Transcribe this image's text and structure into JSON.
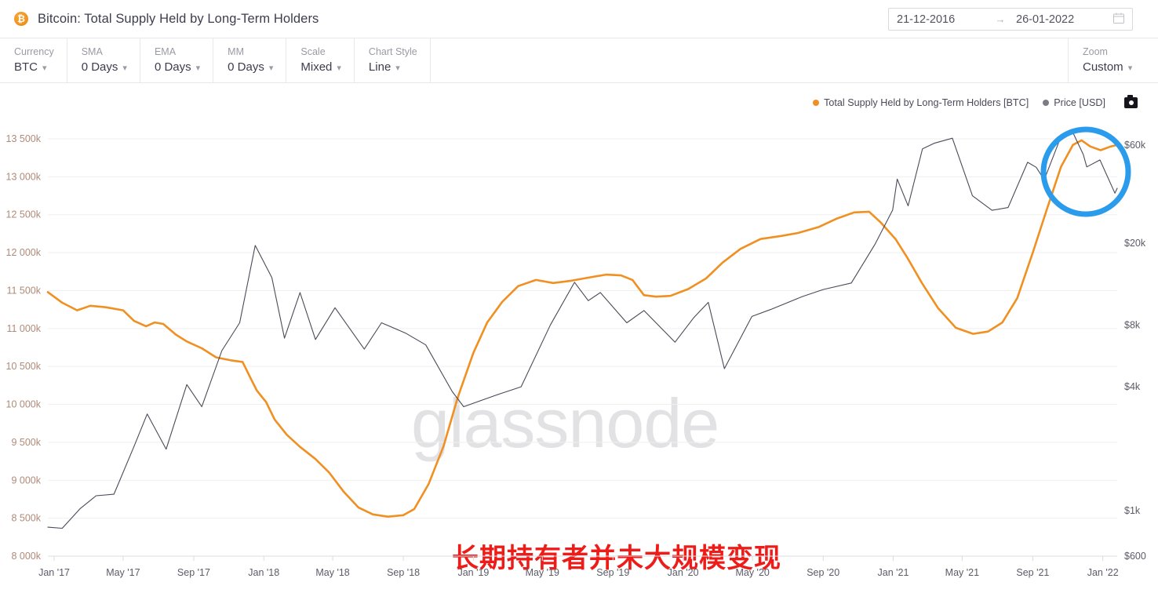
{
  "header": {
    "logo_icon": "bitcoin-icon",
    "logo_glyph": "₿",
    "title": "Bitcoin: Total Supply Held by Long-Term Holders",
    "date_from": "21-12-2016",
    "date_arrow": "→",
    "date_to": "26-01-2022",
    "calendar_icon": "calendar-icon"
  },
  "toolbar": {
    "items": [
      {
        "label": "Currency",
        "value": "BTC"
      },
      {
        "label": "SMA",
        "value": "0 Days"
      },
      {
        "label": "EMA",
        "value": "0 Days"
      },
      {
        "label": "MM",
        "value": "0 Days"
      },
      {
        "label": "Scale",
        "value": "Mixed"
      },
      {
        "label": "Chart Style",
        "value": "Line"
      }
    ],
    "zoom": {
      "label": "Zoom",
      "value": "Custom"
    }
  },
  "legend": {
    "items": [
      {
        "label": "Total Supply Held by Long-Term Holders [BTC]",
        "color": "#f09022"
      },
      {
        "label": "Price [USD]",
        "color": "#7b7b86"
      }
    ],
    "camera_icon": "camera-icon"
  },
  "watermark": "glassnode",
  "annotation": {
    "text": "长期持有者并未大规模变现",
    "color": "#ee1c18",
    "circle": {
      "color": "#2b9bec",
      "cx": 1384,
      "cy": 219,
      "r": 54
    }
  },
  "chart_data": {
    "type": "line",
    "title": "Bitcoin: Total Supply Held by Long-Term Holders",
    "xlabel": "",
    "ylabel": "Total Supply Held by Long-Term Holders [BTC]",
    "y2label": "Price [USD]",
    "grid": true,
    "legend_position": "top-right",
    "x_ticks": [
      "Jan '17",
      "May '17",
      "Sep '17",
      "Jan '18",
      "May '18",
      "Sep '18",
      "Jan '19",
      "May '19",
      "Sep '19",
      "Jan '20",
      "May '20",
      "Sep '20",
      "Jan '21",
      "May '21",
      "Sep '21",
      "Jan '22"
    ],
    "y_left_ticks": [
      "13 500k",
      "13 000k",
      "12 500k",
      "12 000k",
      "11 500k",
      "11 000k",
      "10 500k",
      "10 000k",
      "9 500k",
      "9 000k",
      "8 500k",
      "8 000k"
    ],
    "y_left_values": [
      13500000,
      13000000,
      12500000,
      12000000,
      11500000,
      11000000,
      10500000,
      10000000,
      9500000,
      9000000,
      8500000,
      8000000
    ],
    "y_left_range": [
      8000000,
      13500000
    ],
    "y_right_ticks": [
      "$60k",
      "$20k",
      "$8k",
      "$4k",
      "$1k",
      "$600"
    ],
    "y_right_values": [
      60000,
      20000,
      8000,
      4000,
      1000,
      600
    ],
    "y_right_scale": "log",
    "y_right_range": [
      600,
      70000
    ],
    "x_range": [
      "2016-12-21",
      "2022-01-26"
    ],
    "series": [
      {
        "name": "Total Supply Held by Long-Term Holders [BTC]",
        "color": "#f09022",
        "axis": "left",
        "unit": "BTC",
        "points": [
          {
            "x": "2016-12-21",
            "y": 11480000
          },
          {
            "x": "2017-01-15",
            "y": 11340000
          },
          {
            "x": "2017-02-10",
            "y": 11240000
          },
          {
            "x": "2017-03-05",
            "y": 11300000
          },
          {
            "x": "2017-04-01",
            "y": 11280000
          },
          {
            "x": "2017-05-01",
            "y": 11240000
          },
          {
            "x": "2017-05-20",
            "y": 11100000
          },
          {
            "x": "2017-06-10",
            "y": 11030000
          },
          {
            "x": "2017-06-25",
            "y": 11080000
          },
          {
            "x": "2017-07-10",
            "y": 11060000
          },
          {
            "x": "2017-08-01",
            "y": 10920000
          },
          {
            "x": "2017-08-20",
            "y": 10830000
          },
          {
            "x": "2017-09-15",
            "y": 10740000
          },
          {
            "x": "2017-10-10",
            "y": 10620000
          },
          {
            "x": "2017-11-05",
            "y": 10580000
          },
          {
            "x": "2017-11-25",
            "y": 10560000
          },
          {
            "x": "2017-12-10",
            "y": 10330000
          },
          {
            "x": "2017-12-20",
            "y": 10180000
          },
          {
            "x": "2018-01-05",
            "y": 10030000
          },
          {
            "x": "2018-01-20",
            "y": 9800000
          },
          {
            "x": "2018-02-10",
            "y": 9600000
          },
          {
            "x": "2018-03-05",
            "y": 9440000
          },
          {
            "x": "2018-04-01",
            "y": 9280000
          },
          {
            "x": "2018-04-25",
            "y": 9100000
          },
          {
            "x": "2018-05-20",
            "y": 8850000
          },
          {
            "x": "2018-06-15",
            "y": 8640000
          },
          {
            "x": "2018-07-10",
            "y": 8550000
          },
          {
            "x": "2018-08-05",
            "y": 8520000
          },
          {
            "x": "2018-09-01",
            "y": 8540000
          },
          {
            "x": "2018-09-20",
            "y": 8620000
          },
          {
            "x": "2018-10-15",
            "y": 8950000
          },
          {
            "x": "2018-11-10",
            "y": 9450000
          },
          {
            "x": "2018-12-05",
            "y": 10100000
          },
          {
            "x": "2019-01-01",
            "y": 10680000
          },
          {
            "x": "2019-01-25",
            "y": 11080000
          },
          {
            "x": "2019-02-20",
            "y": 11350000
          },
          {
            "x": "2019-03-20",
            "y": 11560000
          },
          {
            "x": "2019-04-20",
            "y": 11640000
          },
          {
            "x": "2019-05-20",
            "y": 11600000
          },
          {
            "x": "2019-06-20",
            "y": 11630000
          },
          {
            "x": "2019-07-20",
            "y": 11670000
          },
          {
            "x": "2019-08-20",
            "y": 11710000
          },
          {
            "x": "2019-09-15",
            "y": 11700000
          },
          {
            "x": "2019-10-05",
            "y": 11640000
          },
          {
            "x": "2019-10-25",
            "y": 11440000
          },
          {
            "x": "2019-11-15",
            "y": 11420000
          },
          {
            "x": "2019-12-10",
            "y": 11430000
          },
          {
            "x": "2020-01-10",
            "y": 11520000
          },
          {
            "x": "2020-02-10",
            "y": 11660000
          },
          {
            "x": "2020-03-10",
            "y": 11870000
          },
          {
            "x": "2020-04-10",
            "y": 12050000
          },
          {
            "x": "2020-05-15",
            "y": 12180000
          },
          {
            "x": "2020-06-20",
            "y": 12220000
          },
          {
            "x": "2020-07-20",
            "y": 12260000
          },
          {
            "x": "2020-08-25",
            "y": 12340000
          },
          {
            "x": "2020-09-25",
            "y": 12450000
          },
          {
            "x": "2020-10-25",
            "y": 12530000
          },
          {
            "x": "2020-11-20",
            "y": 12540000
          },
          {
            "x": "2020-12-10",
            "y": 12400000
          },
          {
            "x": "2021-01-05",
            "y": 12180000
          },
          {
            "x": "2021-01-25",
            "y": 11940000
          },
          {
            "x": "2021-02-20",
            "y": 11600000
          },
          {
            "x": "2021-03-20",
            "y": 11270000
          },
          {
            "x": "2021-04-20",
            "y": 11010000
          },
          {
            "x": "2021-05-20",
            "y": 10930000
          },
          {
            "x": "2021-06-15",
            "y": 10960000
          },
          {
            "x": "2021-07-10",
            "y": 11080000
          },
          {
            "x": "2021-08-05",
            "y": 11400000
          },
          {
            "x": "2021-09-01",
            "y": 12000000
          },
          {
            "x": "2021-09-25",
            "y": 12560000
          },
          {
            "x": "2021-10-20",
            "y": 13130000
          },
          {
            "x": "2021-11-10",
            "y": 13420000
          },
          {
            "x": "2021-11-25",
            "y": 13480000
          },
          {
            "x": "2021-12-10",
            "y": 13400000
          },
          {
            "x": "2021-12-28",
            "y": 13350000
          },
          {
            "x": "2022-01-15",
            "y": 13400000
          },
          {
            "x": "2022-01-26",
            "y": 13420000
          }
        ]
      },
      {
        "name": "Price [USD]",
        "color": "#4a4a58",
        "axis": "right",
        "unit": "USD",
        "points": [
          {
            "x": "2016-12-21",
            "y": 830
          },
          {
            "x": "2017-01-15",
            "y": 820
          },
          {
            "x": "2017-02-15",
            "y": 1020
          },
          {
            "x": "2017-03-15",
            "y": 1180
          },
          {
            "x": "2017-04-15",
            "y": 1200
          },
          {
            "x": "2017-05-20",
            "y": 2050
          },
          {
            "x": "2017-06-12",
            "y": 2950
          },
          {
            "x": "2017-07-15",
            "y": 1990
          },
          {
            "x": "2017-08-20",
            "y": 4100
          },
          {
            "x": "2017-09-15",
            "y": 3200
          },
          {
            "x": "2017-10-20",
            "y": 6000
          },
          {
            "x": "2017-11-20",
            "y": 8200
          },
          {
            "x": "2017-12-17",
            "y": 19500
          },
          {
            "x": "2018-01-15",
            "y": 13600
          },
          {
            "x": "2018-02-06",
            "y": 6900
          },
          {
            "x": "2018-03-05",
            "y": 11500
          },
          {
            "x": "2018-04-01",
            "y": 6800
          },
          {
            "x": "2018-05-05",
            "y": 9700
          },
          {
            "x": "2018-06-25",
            "y": 6100
          },
          {
            "x": "2018-07-25",
            "y": 8200
          },
          {
            "x": "2018-09-05",
            "y": 7300
          },
          {
            "x": "2018-10-10",
            "y": 6400
          },
          {
            "x": "2018-11-25",
            "y": 3800
          },
          {
            "x": "2018-12-15",
            "y": 3200
          },
          {
            "x": "2019-02-10",
            "y": 3650
          },
          {
            "x": "2019-03-25",
            "y": 4000
          },
          {
            "x": "2019-05-15",
            "y": 8000
          },
          {
            "x": "2019-06-26",
            "y": 12900
          },
          {
            "x": "2019-07-20",
            "y": 10500
          },
          {
            "x": "2019-08-10",
            "y": 11500
          },
          {
            "x": "2019-09-25",
            "y": 8200
          },
          {
            "x": "2019-10-25",
            "y": 9400
          },
          {
            "x": "2019-12-18",
            "y": 6600
          },
          {
            "x": "2020-01-20",
            "y": 8700
          },
          {
            "x": "2020-02-14",
            "y": 10300
          },
          {
            "x": "2020-03-13",
            "y": 4900
          },
          {
            "x": "2020-04-30",
            "y": 8800
          },
          {
            "x": "2020-06-01",
            "y": 9500
          },
          {
            "x": "2020-07-27",
            "y": 11000
          },
          {
            "x": "2020-09-01",
            "y": 11900
          },
          {
            "x": "2020-10-20",
            "y": 12800
          },
          {
            "x": "2020-11-30",
            "y": 19700
          },
          {
            "x": "2020-12-31",
            "y": 29000
          },
          {
            "x": "2021-01-08",
            "y": 41000
          },
          {
            "x": "2021-01-27",
            "y": 30400
          },
          {
            "x": "2021-02-21",
            "y": 57500
          },
          {
            "x": "2021-03-13",
            "y": 61200
          },
          {
            "x": "2021-04-14",
            "y": 64800
          },
          {
            "x": "2021-05-19",
            "y": 34000
          },
          {
            "x": "2021-06-22",
            "y": 28900
          },
          {
            "x": "2021-07-20",
            "y": 29800
          },
          {
            "x": "2021-08-23",
            "y": 49500
          },
          {
            "x": "2021-09-07",
            "y": 46800
          },
          {
            "x": "2021-09-21",
            "y": 40700
          },
          {
            "x": "2021-10-20",
            "y": 66000
          },
          {
            "x": "2021-11-10",
            "y": 69000
          },
          {
            "x": "2021-11-28",
            "y": 54000
          },
          {
            "x": "2021-12-04",
            "y": 47000
          },
          {
            "x": "2021-12-27",
            "y": 50800
          },
          {
            "x": "2022-01-22",
            "y": 35000
          },
          {
            "x": "2022-01-26",
            "y": 37000
          }
        ]
      }
    ]
  }
}
